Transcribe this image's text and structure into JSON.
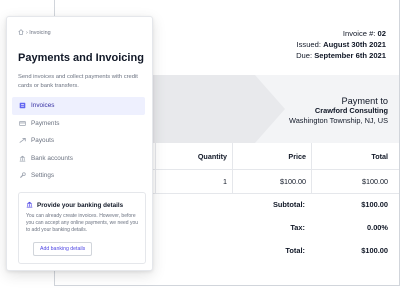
{
  "invoice": {
    "number_label": "Invoice #:",
    "number": "02",
    "issued_label": "Issued:",
    "issued": "August 30th 2021",
    "due_label": "Due:",
    "due": "September 6th 2021",
    "payment_to_label": "Payment to",
    "payee_name": "Crawford Consulting",
    "payee_address": "Washington Township, NJ, US",
    "columns": [
      "Quantity",
      "Price",
      "Total"
    ],
    "items": [
      {
        "quantity": "1",
        "price": "$100.00",
        "total": "$100.00"
      }
    ],
    "subtotal_label": "Subtotal:",
    "subtotal": "$100.00",
    "tax_label": "Tax:",
    "tax": "0.00%",
    "total_label": "Total:",
    "total": "$100.00"
  },
  "panel": {
    "breadcrumb": "› Invoicing",
    "title": "Payments and Invoicing",
    "description": "Send invoices and collect payments with credit cards or bank transfers.",
    "nav": [
      {
        "label": "Invoices",
        "icon": "invoice-icon",
        "active": true
      },
      {
        "label": "Payments",
        "icon": "credit-card-icon",
        "active": false
      },
      {
        "label": "Payouts",
        "icon": "payout-icon",
        "active": false
      },
      {
        "label": "Bank accounts",
        "icon": "bank-icon",
        "active": false
      },
      {
        "label": "Settings",
        "icon": "wrench-icon",
        "active": false
      }
    ],
    "bank_card": {
      "title": "Provide your banking details",
      "text": "You can already create invoices. However, before you can accept any online payments, we need you to add your banking details.",
      "button": "Add banking details"
    }
  },
  "colors": {
    "accent": "#4f46e5",
    "active_bg": "#eef0fe",
    "band_bg": "#f3f4f6"
  }
}
